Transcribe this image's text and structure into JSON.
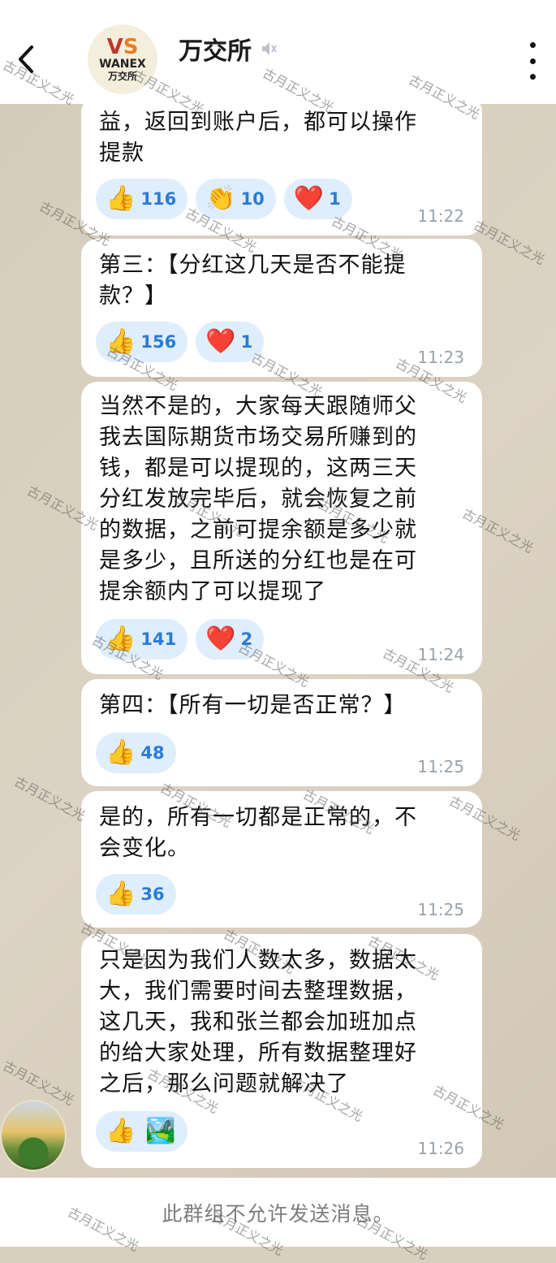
{
  "header": {
    "title": "万交所",
    "logo_mark_v": "V",
    "logo_mark_s": "S",
    "logo_name": "WANEX",
    "logo_sub": "万交所"
  },
  "messages": [
    {
      "text": "益，返回到账户后，都可以操作\n提款",
      "reactions": [
        {
          "emoji": "👍",
          "count": "116"
        },
        {
          "emoji": "👏",
          "count": "10"
        },
        {
          "emoji": "❤️",
          "count": "1"
        }
      ],
      "time": "11:22"
    },
    {
      "text": "第三：【分红这几天是否不能提\n款？】",
      "reactions": [
        {
          "emoji": "👍",
          "count": "156"
        },
        {
          "emoji": "❤️",
          "count": "1"
        }
      ],
      "time": "11:23"
    },
    {
      "text": "当然不是的，大家每天跟随师父\n我去国际期货市场交易所赚到的\n钱，都是可以提现的，这两三天\n分红发放完毕后，就会恢复之前\n的数据，之前可提余额是多少就\n是多少，且所送的分红也是在可\n提余额内了可以提现了",
      "reactions": [
        {
          "emoji": "👍",
          "count": "141"
        },
        {
          "emoji": "❤️",
          "count": "2"
        }
      ],
      "time": "11:24"
    },
    {
      "text": "第四：【所有一切是否正常？】",
      "reactions": [
        {
          "emoji": "👍",
          "count": "48"
        }
      ],
      "time": "11:25"
    },
    {
      "text": "是的，所有一切都是正常的，不\n会变化。",
      "reactions": [
        {
          "emoji": "👍",
          "count": "36"
        }
      ],
      "time": "11:25"
    },
    {
      "text": "只是因为我们人数太多，数据太\n大，我们需要时间去整理数据，\n这几天，我和张兰都会加班加点\n的给大家处理，所有数据整理好\n之后，那么问题就解决了",
      "reactions": [
        {
          "emoji": "👍",
          "count": ""
        },
        {
          "emoji": "🏞️",
          "count": ""
        }
      ],
      "time": "11:26"
    }
  ],
  "footer": {
    "notice": "此群组不允许发送消息。"
  },
  "watermark_text": "古月正义之光",
  "icons": {
    "back": "chevron-left-icon",
    "mute": "speaker-mute-icon",
    "menu": "more-vertical-icon"
  }
}
